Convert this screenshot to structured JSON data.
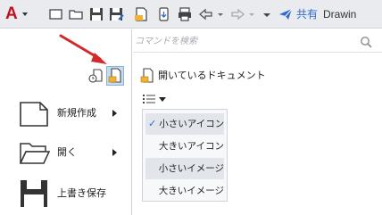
{
  "toolbar": {
    "app_icon": "autocad-a-logo",
    "icons": [
      "new-icon",
      "open-icon",
      "save-icon",
      "save-as-icon",
      "open-from-web-icon",
      "save-to-web-icon",
      "print-icon",
      "undo-icon",
      "redo-icon",
      "customize-caret-icon"
    ],
    "share_label": "共有",
    "share_icon": "share-paper-plane-icon",
    "title": "Drawin"
  },
  "left_menu": {
    "top_icons": [
      "recent-documents-icon",
      "open-documents-icon"
    ],
    "items": [
      {
        "label": "新規作成",
        "icon": "new-document-icon",
        "has_submenu": true
      },
      {
        "label": "開く",
        "icon": "folder-open-icon",
        "has_submenu": true
      },
      {
        "label": "上書き保存",
        "icon": "save-floppy-icon",
        "has_submenu": false
      }
    ]
  },
  "right_panel": {
    "search_placeholder": "コマンドを検索",
    "section_title": "開いているドキュメント",
    "view_options": [
      {
        "label": "小さいアイコン",
        "checked": true
      },
      {
        "label": "大きいアイコン",
        "checked": false
      },
      {
        "label": "小さいイメージ",
        "checked": false
      },
      {
        "label": "大きいイメージ",
        "checked": false
      }
    ]
  },
  "colors": {
    "accent": "#2f6bd2",
    "app_red": "#c4121a",
    "annotation_arrow": "#d22a2a"
  }
}
